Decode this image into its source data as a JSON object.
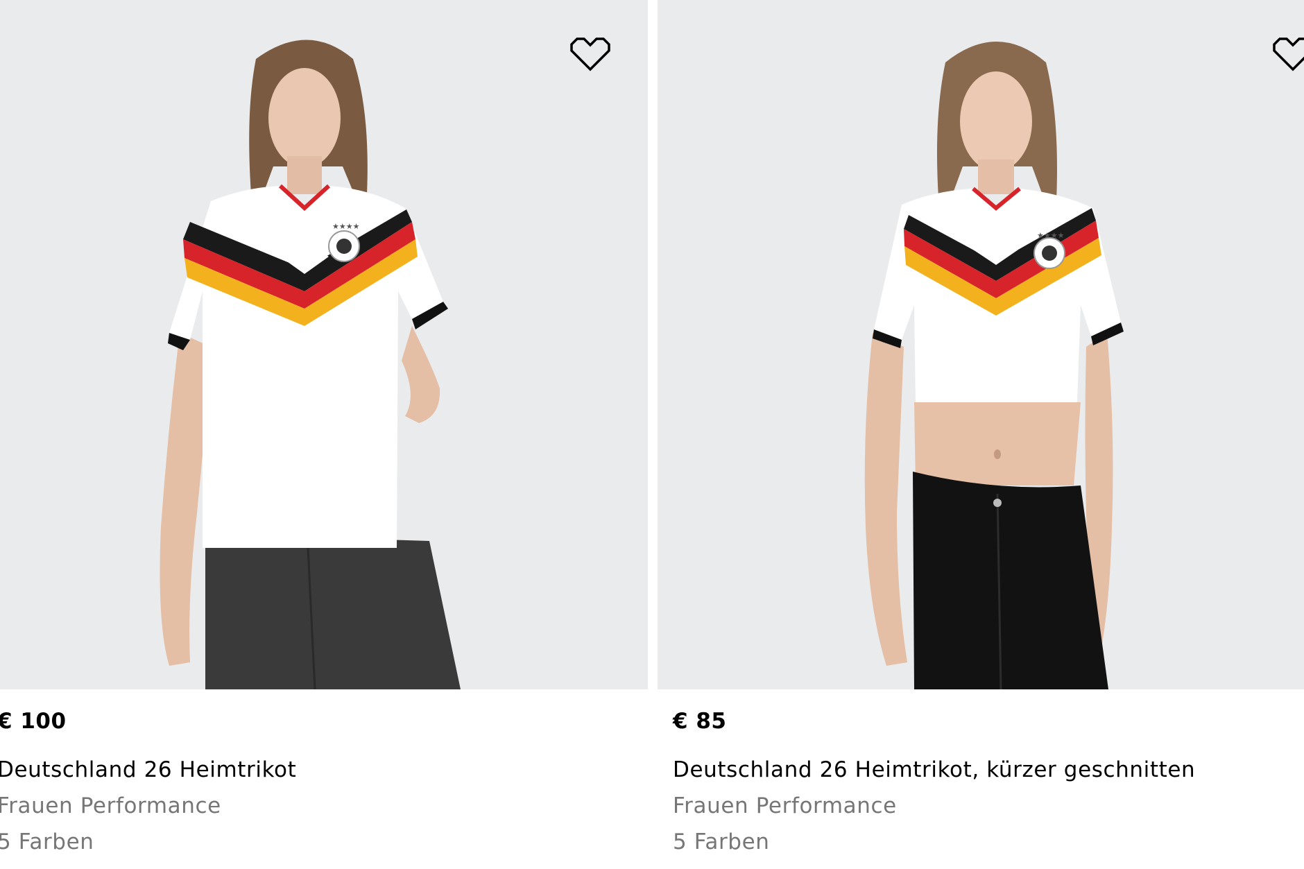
{
  "products": [
    {
      "price": "€ 100",
      "title": "Deutschland 26 Heimtrikot",
      "subtitle": "Frauen Performance",
      "colors": "5 Farben",
      "image_alt": "Frau im weißen Deutschland Trikot mit schwarz-rot-goldenen Streifen"
    },
    {
      "price": "€ 85",
      "title": "Deutschland 26 Heimtrikot, kürzer geschnitten",
      "subtitle": "Frauen Performance",
      "colors": "5 Farben",
      "image_alt": "Frau im kurz geschnittenen weißen Deutschland Trikot und schwarzer Jeans"
    }
  ],
  "icons": {
    "wishlist": "heart-outline-icon"
  },
  "colors": {
    "image_background": "#eaebed",
    "text_primary": "#000000",
    "text_secondary": "#767677",
    "flag_black": "#1a1a1a",
    "flag_red": "#d6242a",
    "flag_gold": "#f2b11d"
  }
}
